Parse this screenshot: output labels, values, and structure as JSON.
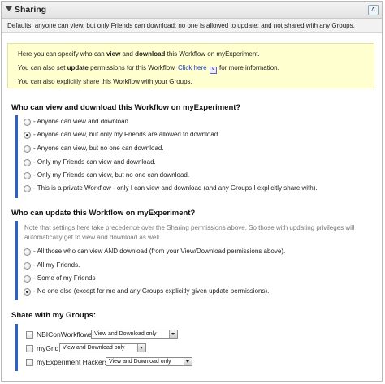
{
  "header": {
    "title": "Sharing",
    "collapse_icon": "double-chevron-up-icon"
  },
  "summary": "Defaults: anyone can view, but only Friends can download; no one is allowed to update; and not shared with any Groups.",
  "info": {
    "line1_pre": "Here you can specify who can ",
    "line1_b1": "view",
    "line1_and": " and ",
    "line1_b2": "download",
    "line1_post": " this Workflow on myExperiment.",
    "line2_pre": "You can also set ",
    "line2_b": "update",
    "line2_mid": " permissions for this Workflow. ",
    "line2_link": "Click here",
    "line2_post": " for more information.",
    "line3": "You can also explicitly share this Workflow with your Groups."
  },
  "view_section": {
    "title": "Who can view and download this Workflow on myExperiment?",
    "options": [
      {
        "label": "- Anyone can view and download.",
        "selected": false
      },
      {
        "label": "- Anyone can view, but only my Friends are allowed to download.",
        "selected": true
      },
      {
        "label": "- Anyone can view, but no one can download.",
        "selected": false
      },
      {
        "label": "- Only my Friends can view and download.",
        "selected": false
      },
      {
        "label": "- Only my Friends can view, but no one can download.",
        "selected": false
      },
      {
        "label": "- This is a private Workflow - only I can view and download (and any Groups I explicitly share with).",
        "selected": false
      }
    ]
  },
  "update_section": {
    "title": "Who can update this Workflow on myExperiment?",
    "note": "Note that settings here take precedence over the Sharing permissions above. So those with updating privileges will automatically get to view and download as well.",
    "options": [
      {
        "label": "- All those who can view AND download (from your View/Download permissions above).",
        "selected": false
      },
      {
        "label": "- All my Friends.",
        "selected": false
      },
      {
        "label": "- Some of my Friends",
        "selected": false
      },
      {
        "label": "- No one else (except for me and any Groups explicitly given update permissions).",
        "selected": true
      }
    ]
  },
  "groups_section": {
    "title": "Share with my Groups:",
    "groups": [
      {
        "name": "NBIConWorkflows",
        "checked": false,
        "permission": "View and Download only"
      },
      {
        "name": "myGrid",
        "checked": false,
        "permission": "View and Download only"
      },
      {
        "name": "myExperiment Hackers",
        "checked": false,
        "permission": "View and Download only"
      }
    ]
  }
}
